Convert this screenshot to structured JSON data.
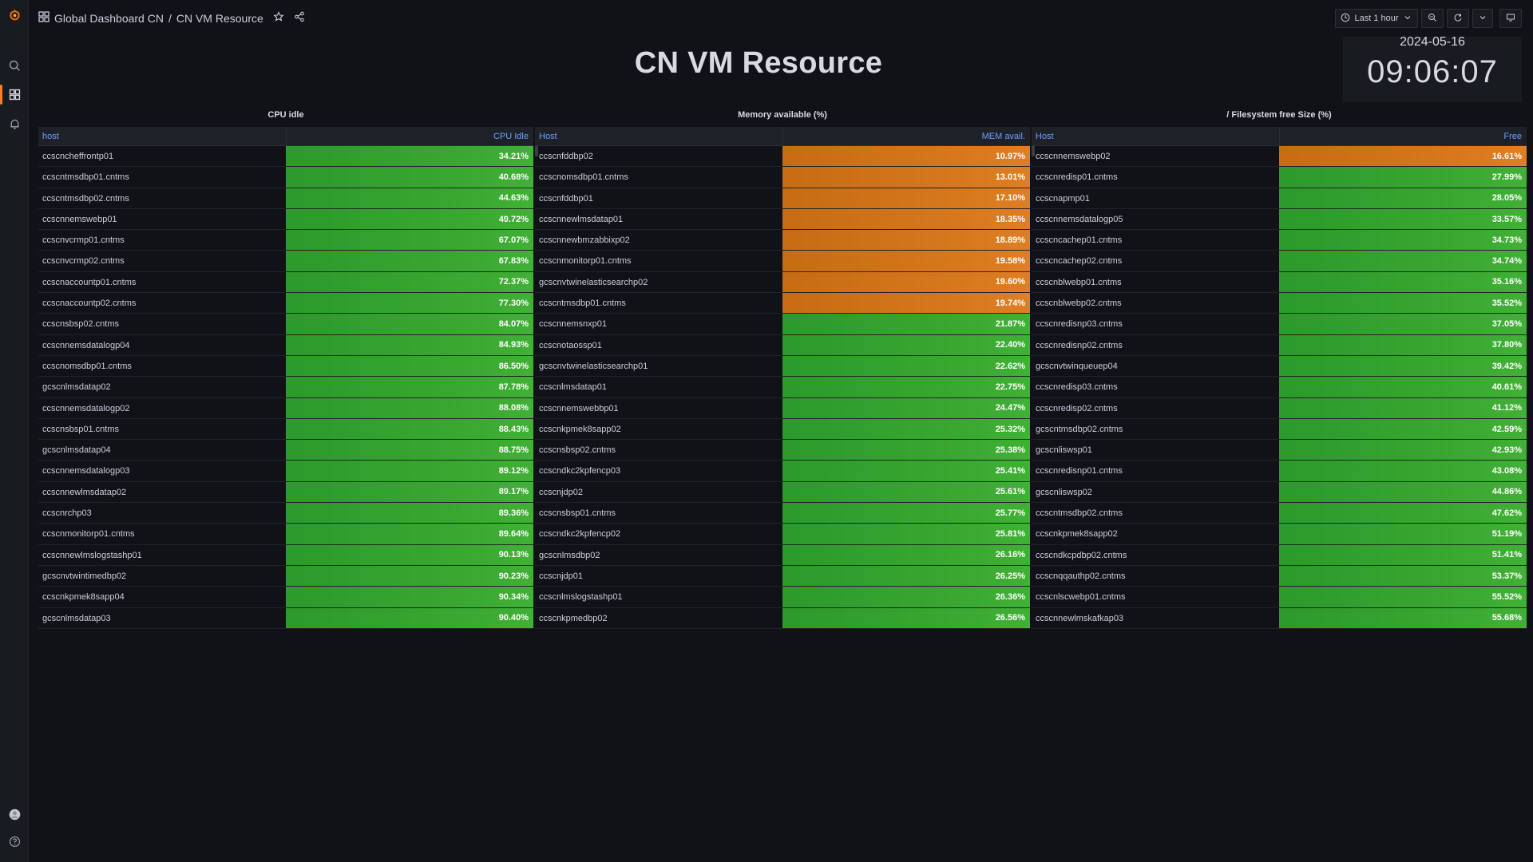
{
  "breadcrumb": {
    "folder": "Global Dashboard CN",
    "dashboard": "CN VM Resource"
  },
  "toolbar": {
    "time_range": "Last 1 hour"
  },
  "title": "CN VM Resource",
  "clock": {
    "date": "2024-05-16",
    "time": "09:06:07"
  },
  "colors": {
    "green": "#37a52f",
    "orange": "#d4761b",
    "accent": "#ff7d1f",
    "header_text": "#6e9fff"
  },
  "panels": [
    {
      "title": "CPU idle",
      "col_left": "host",
      "col_right": "CPU Idle",
      "rows": [
        {
          "host": "ccscncheffrontp01",
          "value": "34.21%",
          "level": "green"
        },
        {
          "host": "ccscntmsdbp01.cntms",
          "value": "40.68%",
          "level": "green"
        },
        {
          "host": "ccscntmsdbp02.cntms",
          "value": "44.63%",
          "level": "green"
        },
        {
          "host": "ccscnnemswebp01",
          "value": "49.72%",
          "level": "green"
        },
        {
          "host": "ccscnvcrmp01.cntms",
          "value": "67.07%",
          "level": "green"
        },
        {
          "host": "ccscnvcrmp02.cntms",
          "value": "67.83%",
          "level": "green"
        },
        {
          "host": "ccscnaccountp01.cntms",
          "value": "72.37%",
          "level": "green"
        },
        {
          "host": "ccscnaccountp02.cntms",
          "value": "77.30%",
          "level": "green"
        },
        {
          "host": "ccscnsbsp02.cntms",
          "value": "84.07%",
          "level": "green"
        },
        {
          "host": "ccscnnemsdatalogp04",
          "value": "84.93%",
          "level": "green"
        },
        {
          "host": "ccscnomsdbp01.cntms",
          "value": "86.50%",
          "level": "green"
        },
        {
          "host": "gcscnlmsdatap02",
          "value": "87.78%",
          "level": "green"
        },
        {
          "host": "ccscnnemsdatalogp02",
          "value": "88.08%",
          "level": "green"
        },
        {
          "host": "ccscnsbsp01.cntms",
          "value": "88.43%",
          "level": "green"
        },
        {
          "host": "gcscnlmsdatap04",
          "value": "88.75%",
          "level": "green"
        },
        {
          "host": "ccscnnemsdatalogp03",
          "value": "89.12%",
          "level": "green"
        },
        {
          "host": "ccscnnewlmsdatap02",
          "value": "89.17%",
          "level": "green"
        },
        {
          "host": "ccscnrchp03",
          "value": "89.36%",
          "level": "green"
        },
        {
          "host": "ccscnmonitorp01.cntms",
          "value": "89.64%",
          "level": "green"
        },
        {
          "host": "ccscnnewlmslogstashp01",
          "value": "90.13%",
          "level": "green"
        },
        {
          "host": "gcscnvtwintimedbp02",
          "value": "90.23%",
          "level": "green"
        },
        {
          "host": "ccscnkpmek8sapp04",
          "value": "90.34%",
          "level": "green"
        },
        {
          "host": "gcscnlmsdatap03",
          "value": "90.40%",
          "level": "green"
        }
      ]
    },
    {
      "title": "Memory available (%)",
      "col_left": "Host",
      "col_right": "MEM avail.",
      "rows": [
        {
          "host": "ccscnfddbp02",
          "value": "10.97%",
          "level": "orange"
        },
        {
          "host": "ccscnomsdbp01.cntms",
          "value": "13.01%",
          "level": "orange"
        },
        {
          "host": "ccscnfddbp01",
          "value": "17.10%",
          "level": "orange"
        },
        {
          "host": "ccscnnewlmsdatap01",
          "value": "18.35%",
          "level": "orange"
        },
        {
          "host": "ccscnnewbmzabbixp02",
          "value": "18.89%",
          "level": "orange"
        },
        {
          "host": "ccscnmonitorp01.cntms",
          "value": "19.58%",
          "level": "orange"
        },
        {
          "host": "gcscnvtwinelasticsearchp02",
          "value": "19.60%",
          "level": "orange"
        },
        {
          "host": "ccscntmsdbp01.cntms",
          "value": "19.74%",
          "level": "orange"
        },
        {
          "host": "ccscnnemsnxp01",
          "value": "21.87%",
          "level": "green"
        },
        {
          "host": "ccscnotaossp01",
          "value": "22.40%",
          "level": "green"
        },
        {
          "host": "gcscnvtwinelasticsearchp01",
          "value": "22.62%",
          "level": "green"
        },
        {
          "host": "ccscnlmsdatap01",
          "value": "22.75%",
          "level": "green"
        },
        {
          "host": "ccscnnemswebbp01",
          "value": "24.47%",
          "level": "green"
        },
        {
          "host": "ccscnkpmek8sapp02",
          "value": "25.32%",
          "level": "green"
        },
        {
          "host": "ccscnsbsp02.cntms",
          "value": "25.38%",
          "level": "green"
        },
        {
          "host": "ccscndkc2kpfencp03",
          "value": "25.41%",
          "level": "green"
        },
        {
          "host": "ccscnjdp02",
          "value": "25.61%",
          "level": "green"
        },
        {
          "host": "ccscnsbsp01.cntms",
          "value": "25.77%",
          "level": "green"
        },
        {
          "host": "ccscndkc2kpfencp02",
          "value": "25.81%",
          "level": "green"
        },
        {
          "host": "gcscnlmsdbp02",
          "value": "26.16%",
          "level": "green"
        },
        {
          "host": "ccscnjdp01",
          "value": "26.25%",
          "level": "green"
        },
        {
          "host": "ccscnlmslogstashp01",
          "value": "26.36%",
          "level": "green"
        },
        {
          "host": "ccscnkpmedbp02",
          "value": "26.56%",
          "level": "green"
        }
      ]
    },
    {
      "title": "/ Filesystem free Size (%)",
      "col_left": "Host",
      "col_right": "Free",
      "rows": [
        {
          "host": "ccscnnemswebp02",
          "value": "16.61%",
          "level": "orange"
        },
        {
          "host": "ccscnredisp01.cntms",
          "value": "27.99%",
          "level": "green"
        },
        {
          "host": "ccscnapmp01",
          "value": "28.05%",
          "level": "green"
        },
        {
          "host": "ccscnnemsdatalogp05",
          "value": "33.57%",
          "level": "green"
        },
        {
          "host": "ccscncachep01.cntms",
          "value": "34.73%",
          "level": "green"
        },
        {
          "host": "ccscncachep02.cntms",
          "value": "34.74%",
          "level": "green"
        },
        {
          "host": "ccscnblwebp01.cntms",
          "value": "35.16%",
          "level": "green"
        },
        {
          "host": "ccscnblwebp02.cntms",
          "value": "35.52%",
          "level": "green"
        },
        {
          "host": "ccscnredisnp03.cntms",
          "value": "37.05%",
          "level": "green"
        },
        {
          "host": "ccscnredisnp02.cntms",
          "value": "37.80%",
          "level": "green"
        },
        {
          "host": "gcscnvtwinqueuep04",
          "value": "39.42%",
          "level": "green"
        },
        {
          "host": "ccscnredisp03.cntms",
          "value": "40.61%",
          "level": "green"
        },
        {
          "host": "ccscnredisp02.cntms",
          "value": "41.12%",
          "level": "green"
        },
        {
          "host": "gcscntmsdbp02.cntms",
          "value": "42.59%",
          "level": "green"
        },
        {
          "host": "gcscnliswsp01",
          "value": "42.93%",
          "level": "green"
        },
        {
          "host": "ccscnredisnp01.cntms",
          "value": "43.08%",
          "level": "green"
        },
        {
          "host": "gcscnliswsp02",
          "value": "44.86%",
          "level": "green"
        },
        {
          "host": "ccscntmsdbp02.cntms",
          "value": "47.62%",
          "level": "green"
        },
        {
          "host": "ccscnkpmek8sapp02",
          "value": "51.19%",
          "level": "green"
        },
        {
          "host": "ccscndkcpdbp02.cntms",
          "value": "51.41%",
          "level": "green"
        },
        {
          "host": "ccscnqqauthp02.cntms",
          "value": "53.37%",
          "level": "green"
        },
        {
          "host": "ccscnlscwebp01.cntms",
          "value": "55.52%",
          "level": "green"
        },
        {
          "host": "ccscnnewlmskafkap03",
          "value": "55.68%",
          "level": "green"
        }
      ]
    }
  ]
}
